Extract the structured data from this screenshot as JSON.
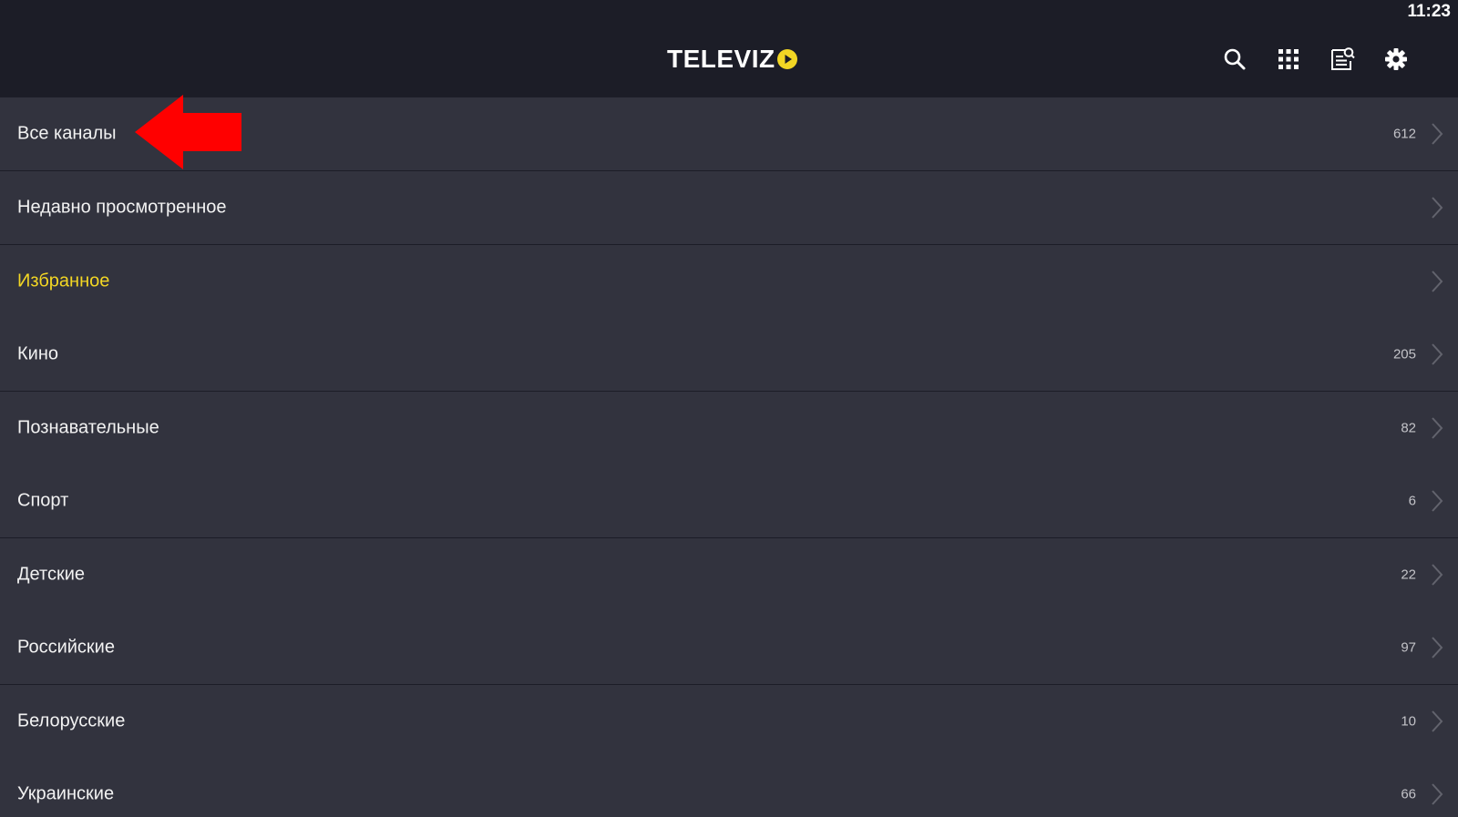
{
  "status_bar": {
    "time": "11:23"
  },
  "header": {
    "logo_text": "TELEVIZ",
    "logo_accent_color": "#f2d624",
    "icons": [
      "search-icon",
      "apps-grid-icon",
      "epg-guide-icon",
      "settings-gear-icon"
    ]
  },
  "annotation": {
    "type": "red-arrow",
    "color": "#ff0000",
    "points_to": "Все каналы"
  },
  "categories": [
    {
      "label": "Все каналы",
      "count": "612"
    },
    {
      "label": "Недавно просмотренное",
      "count": ""
    },
    {
      "label": "Избранное",
      "count": "",
      "highlight": true
    },
    {
      "label": "Кино",
      "count": "205"
    },
    {
      "label": "Познавательные",
      "count": "82"
    },
    {
      "label": "Спорт",
      "count": "6"
    },
    {
      "label": "Детские",
      "count": "22"
    },
    {
      "label": "Российские",
      "count": "97"
    },
    {
      "label": "Белорусские",
      "count": "10"
    },
    {
      "label": "Украинские",
      "count": "66"
    }
  ],
  "colors": {
    "background": "#1c1d27",
    "row_background": "#32333e",
    "highlight_text": "#f2d624"
  }
}
